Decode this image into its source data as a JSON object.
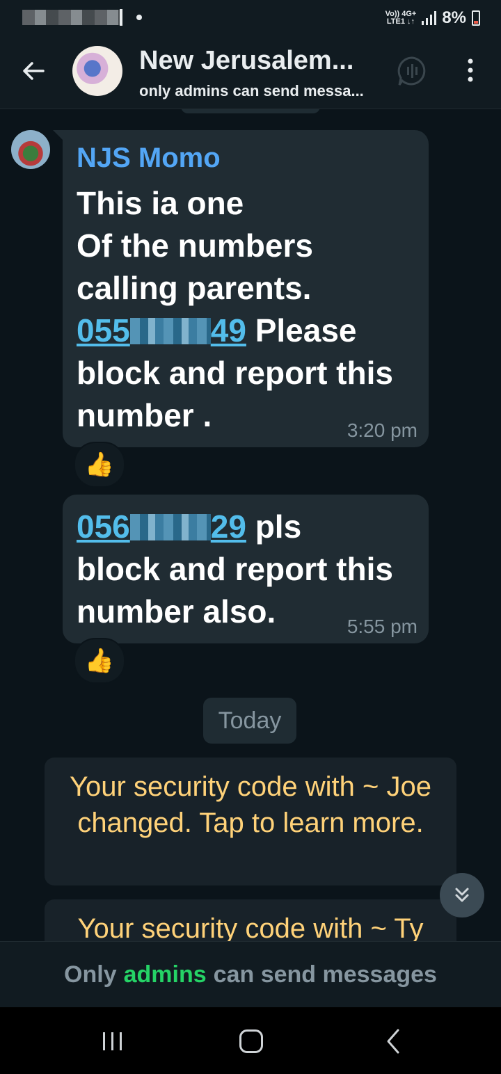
{
  "status_bar": {
    "network_top": "Vo)) 4G+",
    "network_bottom": "LTE1 ↓↑",
    "battery": "8%"
  },
  "header": {
    "title": "New Jerusalem...",
    "subtitle": "only admins can send messa..."
  },
  "messages": [
    {
      "sender": "NJS Momo",
      "lines": [
        "This ia one",
        "Of the numbers",
        "calling parents."
      ],
      "phone_start": "055",
      "phone_end": "49",
      "after_phone": "Please",
      "tail_lines": [
        "block and report this",
        "number ."
      ],
      "time": "3:20 pm",
      "reaction": "👍"
    },
    {
      "phone_start": "056",
      "phone_end": "29",
      "after_phone": "pls",
      "tail_lines": [
        "block and report this",
        "number also."
      ],
      "time": "5:55 pm",
      "reaction": "👍"
    }
  ],
  "date_divider": "Today",
  "system_messages": [
    "Your security code with ~ Joe changed. Tap to learn more.",
    "Your security code with ~ Ty"
  ],
  "footer": {
    "prefix": "Only",
    "highlight": "admins",
    "suffix": "can send messages"
  }
}
